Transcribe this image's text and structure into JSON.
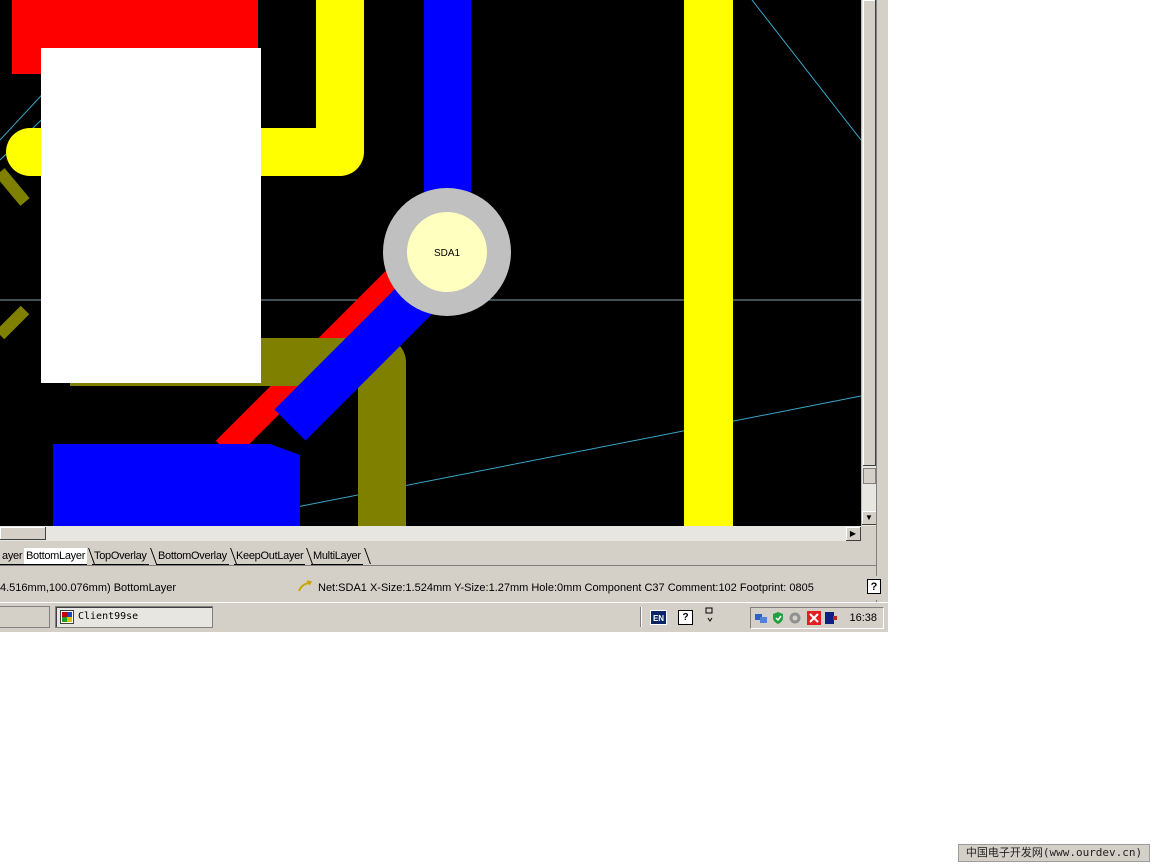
{
  "pcb": {
    "pad_label": "SDA1",
    "colors": {
      "background": "#000000",
      "top_layer_red": "#ff0000",
      "bottom_layer_blue": "#0000ff",
      "top_overlay_yellow": "#ffff00",
      "mid_layer_olive": "#808000",
      "pad_ring": "#c0c0c0",
      "pad_center": "#ffffc0",
      "ratsnest": "#3aa6c8",
      "highlight_box": "#ffffff"
    }
  },
  "scrollbars": {
    "up_icon": "scroll-up-arrow-icon",
    "down_arrow": "▼",
    "right_arrow": "▶"
  },
  "layer_tabs": [
    {
      "label": "ayer",
      "active": false
    },
    {
      "label": "BottomLayer",
      "active": true
    },
    {
      "label": "TopOverlay",
      "active": false
    },
    {
      "label": "BottomOverlay",
      "active": false
    },
    {
      "label": "KeepOutLayer",
      "active": false
    },
    {
      "label": "MultiLayer",
      "active": false
    }
  ],
  "status": {
    "coords_layer": "4.516mm,100.076mm)  BottomLayer",
    "details": "Net:SDA1 X-Size:1.524mm Y-Size:1.27mm Hole:0mm   Component C37 Comment:102 Footprint: 0805",
    "help_glyph": "?"
  },
  "taskbar": {
    "task_label": "Client99se",
    "lang": "EN",
    "help_glyph": "?",
    "clock": "16:38"
  },
  "watermark": "中国电子开发网(www.ourdev.cn)"
}
